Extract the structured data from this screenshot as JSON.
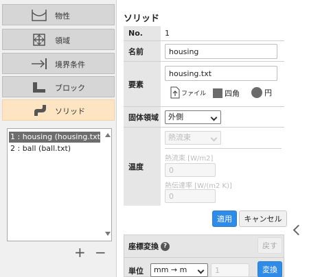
{
  "nav": {
    "items": [
      {
        "label": "物性",
        "icon": "property-icon"
      },
      {
        "label": "領域",
        "icon": "domain-icon"
      },
      {
        "label": "境界条件",
        "icon": "boundary-icon"
      },
      {
        "label": "ブロック",
        "icon": "block-icon"
      },
      {
        "label": "ソリッド",
        "icon": "solid-icon"
      }
    ],
    "active": "ソリッド"
  },
  "solid_list": {
    "items": [
      "1 : housing (housing.txt)",
      "2 : ball (ball.txt)"
    ],
    "selected": "1 : housing (housing.txt)",
    "add_label": "+",
    "remove_label": "−"
  },
  "panel": {
    "title": "ソリッド",
    "no_label": "No.",
    "no_value": "1",
    "name_label": "名前",
    "name_value": "housing",
    "element_label": "要素",
    "element_value": "housing.txt",
    "file_label": "ファイル",
    "square_label": "四角",
    "circle_label": "円",
    "solid_region_label": "固体領域",
    "solid_region_value": "外側",
    "temperature_label": "温度",
    "heat_flux_select": "熱流束",
    "heat_flux_label": "熱流束 [W/m2]",
    "heat_flux_value": "0",
    "heat_transfer_label": "熱伝達率 [W/(m2 K)]",
    "heat_transfer_value": "0",
    "apply_label": "適用",
    "cancel_label": "キャンセル"
  },
  "coord": {
    "title": "座標変換",
    "help_icon": "?",
    "revert_label": "戻す",
    "unit_label": "単位",
    "unit_value": "mm → m",
    "factor_value": "1",
    "convert_label": "変換"
  }
}
